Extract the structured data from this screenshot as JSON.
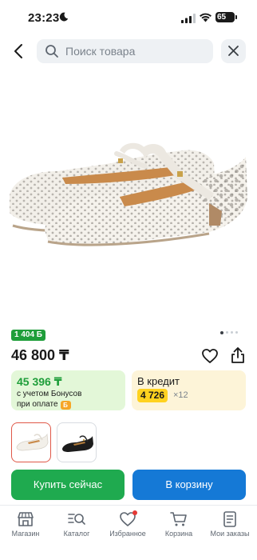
{
  "status_bar": {
    "time": "23:23",
    "battery": "65"
  },
  "search": {
    "placeholder": "Поиск товара"
  },
  "product": {
    "bonus_badge": "1 404 Б",
    "price": "46 800 ₸"
  },
  "bonus_card": {
    "price": "45 396 ₸",
    "line1": "с учетом Бонусов",
    "line2": "при оплате",
    "chip": "Б"
  },
  "credit_card": {
    "title": "В кредит",
    "amount": "4 726",
    "times": "×12"
  },
  "actions": {
    "buy_label": "Купить сейчас",
    "cart_label": "В корзину"
  },
  "tabs": [
    {
      "label": "Магазин",
      "icon": "store-icon"
    },
    {
      "label": "Каталог",
      "icon": "catalog-search-icon"
    },
    {
      "label": "Избранное",
      "icon": "heart-icon"
    },
    {
      "label": "Корзина",
      "icon": "cart-icon"
    },
    {
      "label": "Мои заказы",
      "icon": "orders-icon"
    }
  ],
  "colors": {
    "green": "#1faa4f",
    "blue": "#1579d6",
    "bonus_green": "#1f9e3a",
    "credit_yellow": "#ffd21f",
    "selected_border": "#e05848"
  }
}
